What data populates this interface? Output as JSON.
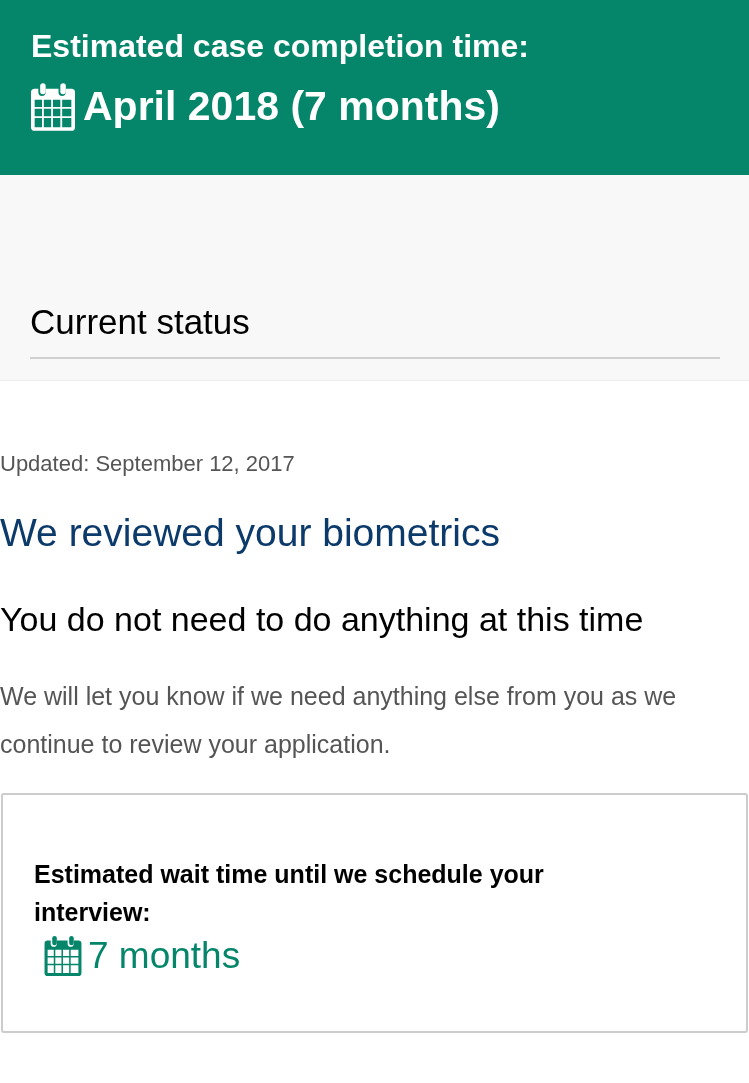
{
  "banner": {
    "title": "Estimated case completion time:",
    "estimate": "April 2018 (7 months)"
  },
  "status_section": {
    "title": "Current status"
  },
  "status": {
    "updated": "Updated: September 12, 2017",
    "heading": "We reviewed your biometrics",
    "action": "You do not need to do anything at this time",
    "description": "We will let you know if we need anything else from you as we continue to review your application."
  },
  "wait_card": {
    "label": "Estimated wait time until we schedule your interview:",
    "value": "7 months"
  }
}
